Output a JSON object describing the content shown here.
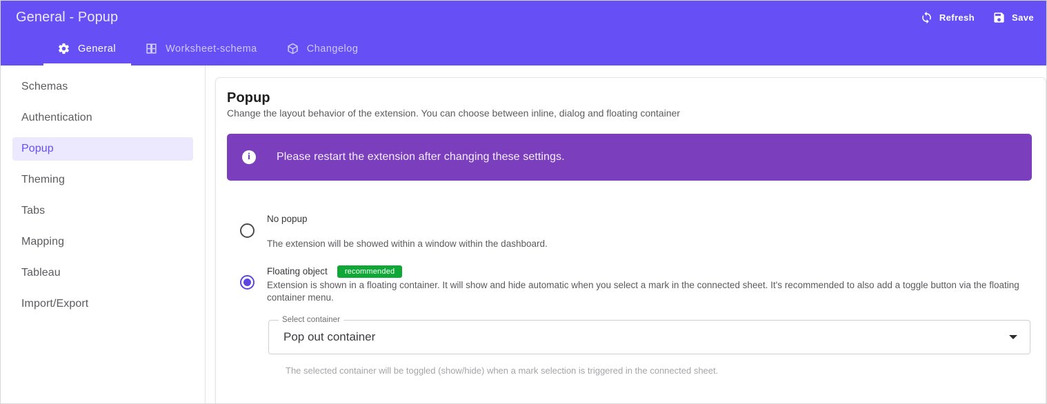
{
  "header": {
    "title": "General - Popup",
    "refresh_label": "Refresh",
    "save_label": "Save",
    "tabs": [
      {
        "label": "General",
        "icon": "gear-icon",
        "active": true
      },
      {
        "label": "Worksheet-schema",
        "icon": "grid-icon",
        "active": false
      },
      {
        "label": "Changelog",
        "icon": "box-icon",
        "active": false
      }
    ],
    "bg_color": "#6650F5"
  },
  "sidebar": {
    "items": [
      {
        "label": "Schemas",
        "active": false
      },
      {
        "label": "Authentication",
        "active": false
      },
      {
        "label": "Popup",
        "active": true
      },
      {
        "label": "Theming",
        "active": false
      },
      {
        "label": "Tabs",
        "active": false
      },
      {
        "label": "Mapping",
        "active": false
      },
      {
        "label": "Tableau",
        "active": false
      },
      {
        "label": "Import/Export",
        "active": false
      }
    ],
    "active_bg": "#ece8fd",
    "active_color": "#6650F5"
  },
  "main": {
    "title": "Popup",
    "subtitle": "Change the layout behavior of the extension. You can choose between inline, dialog and floating container",
    "banner": {
      "text": "Please restart the extension after changing these settings.",
      "icon": "info-icon",
      "bg_color": "#7B3FBE"
    },
    "options": [
      {
        "label": "No popup",
        "description": "The extension will be showed within a window within the dashboard.",
        "selected": false,
        "badge": ""
      },
      {
        "label": "Floating object",
        "badge": "recommended",
        "badge_color": "#0FA836",
        "description": "Extension is shown in a floating container. It will show and hide automatic when you select a mark in the connected sheet. It's recommended to also add a toggle button via the floating container menu.",
        "selected": true
      }
    ],
    "select": {
      "legend": "Select container",
      "value": "Pop out container",
      "helper": "The selected container will be toggled (show/hide) when a mark selection is triggered in the connected sheet.",
      "caret_icon": "chevron-down-icon"
    }
  }
}
